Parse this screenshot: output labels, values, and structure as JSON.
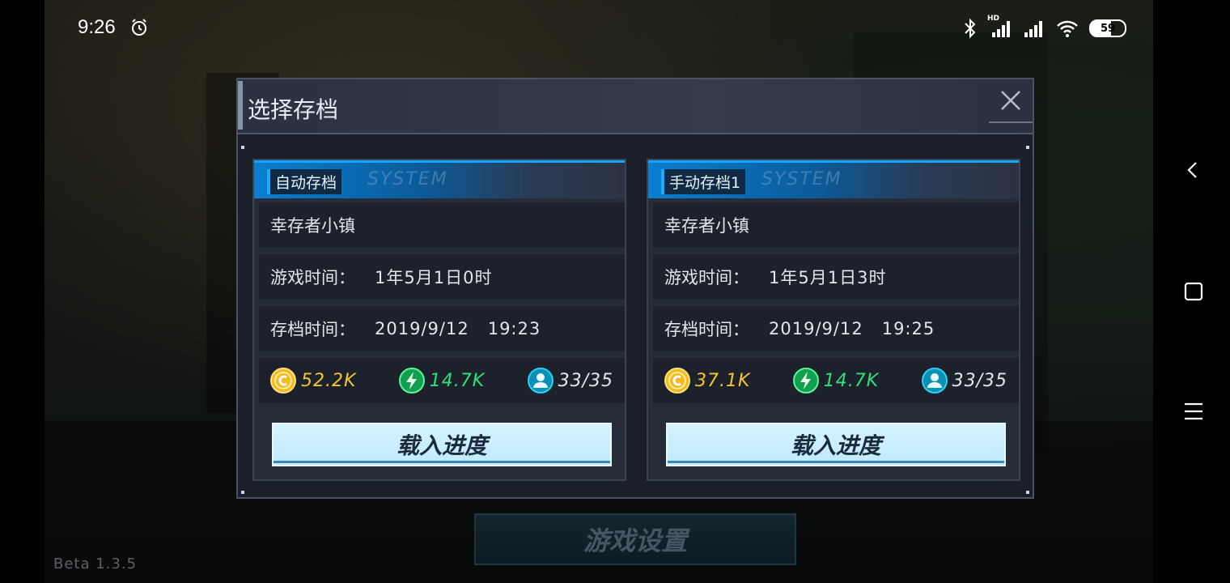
{
  "status_bar": {
    "time": "9:26",
    "battery": "59",
    "network_label": "HD"
  },
  "dialog": {
    "title": "选择存档",
    "slots": [
      {
        "tag": "自动存档",
        "tag_watermark": "SYSTEM",
        "location": "幸存者小镇",
        "game_time_label": "游戏时间：",
        "game_time": "1年5月1日0时",
        "save_time_label": "存档时间：",
        "save_time": "2019/9/12   19:23",
        "coins": "52.2K",
        "energy": "14.7K",
        "survivors": "33/35",
        "load_label": "载入进度"
      },
      {
        "tag": "手动存档1",
        "tag_watermark": "SYSTEM",
        "location": "幸存者小镇",
        "game_time_label": "游戏时间：",
        "game_time": "1年5月1日3时",
        "save_time_label": "存档时间：",
        "save_time": "2019/9/12   19:25",
        "coins": "37.1K",
        "energy": "14.7K",
        "survivors": "33/35",
        "load_label": "载入进度"
      }
    ]
  },
  "background": {
    "settings_button_label": "游戏设置",
    "version": "Beta 1.3.5"
  },
  "colors": {
    "coin": "#f3c532",
    "energy": "#2fe07a",
    "survivor": "#2ad4f0",
    "accent": "#12a7ff",
    "load_button": "#c8eeff"
  },
  "icons": [
    "alarm-icon",
    "bluetooth-icon",
    "signal-icon",
    "wifi-icon",
    "battery-icon",
    "close-icon",
    "coin-icon",
    "energy-icon",
    "survivor-icon",
    "back-icon",
    "home-icon",
    "menu-icon"
  ]
}
